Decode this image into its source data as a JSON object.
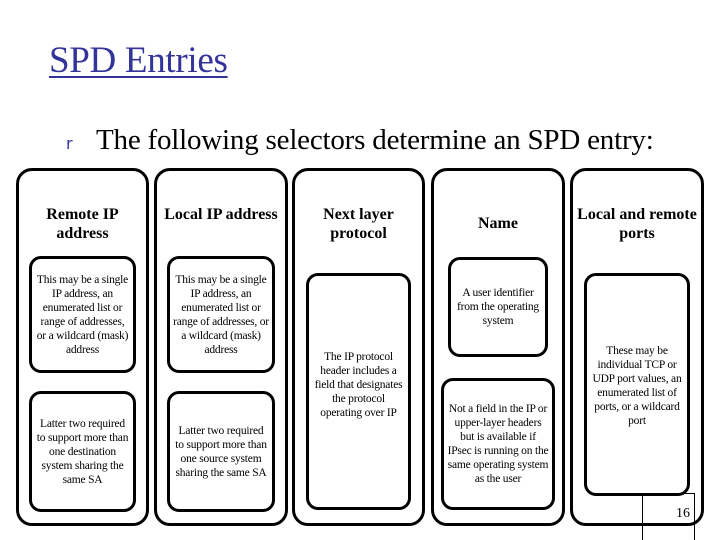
{
  "slide": {
    "title": "SPD Entries",
    "bullet_marker": "r",
    "bullet_text": "The following selectors determine an SPD entry:",
    "page_number": "16",
    "accent_color": "#333399"
  },
  "columns": [
    {
      "heading": "Remote IP address",
      "notes": [
        "This may be a single IP address, an enumerated list or range of addresses, or a wildcard (mask) address",
        "Latter two required to support more than one destination system sharing the same SA"
      ]
    },
    {
      "heading": "Local IP address",
      "notes": [
        "This may be a single IP address, an enumerated list or range of addresses, or a wildcard (mask) address",
        "Latter two required to support more than one source system sharing the same SA"
      ]
    },
    {
      "heading": "Next layer protocol",
      "notes": [
        "The IP protocol header includes a field that designates the protocol operating over IP"
      ]
    },
    {
      "heading": "Name",
      "notes": [
        "A user identifier from the operating system",
        "Not a field in the IP or upper-layer headers but is available if IPsec is running on the same operating system as the user"
      ]
    },
    {
      "heading": "Local and remote ports",
      "notes": [
        "These may be individual TCP or UDP port values, an enumerated list of ports, or a wildcard port"
      ]
    }
  ]
}
